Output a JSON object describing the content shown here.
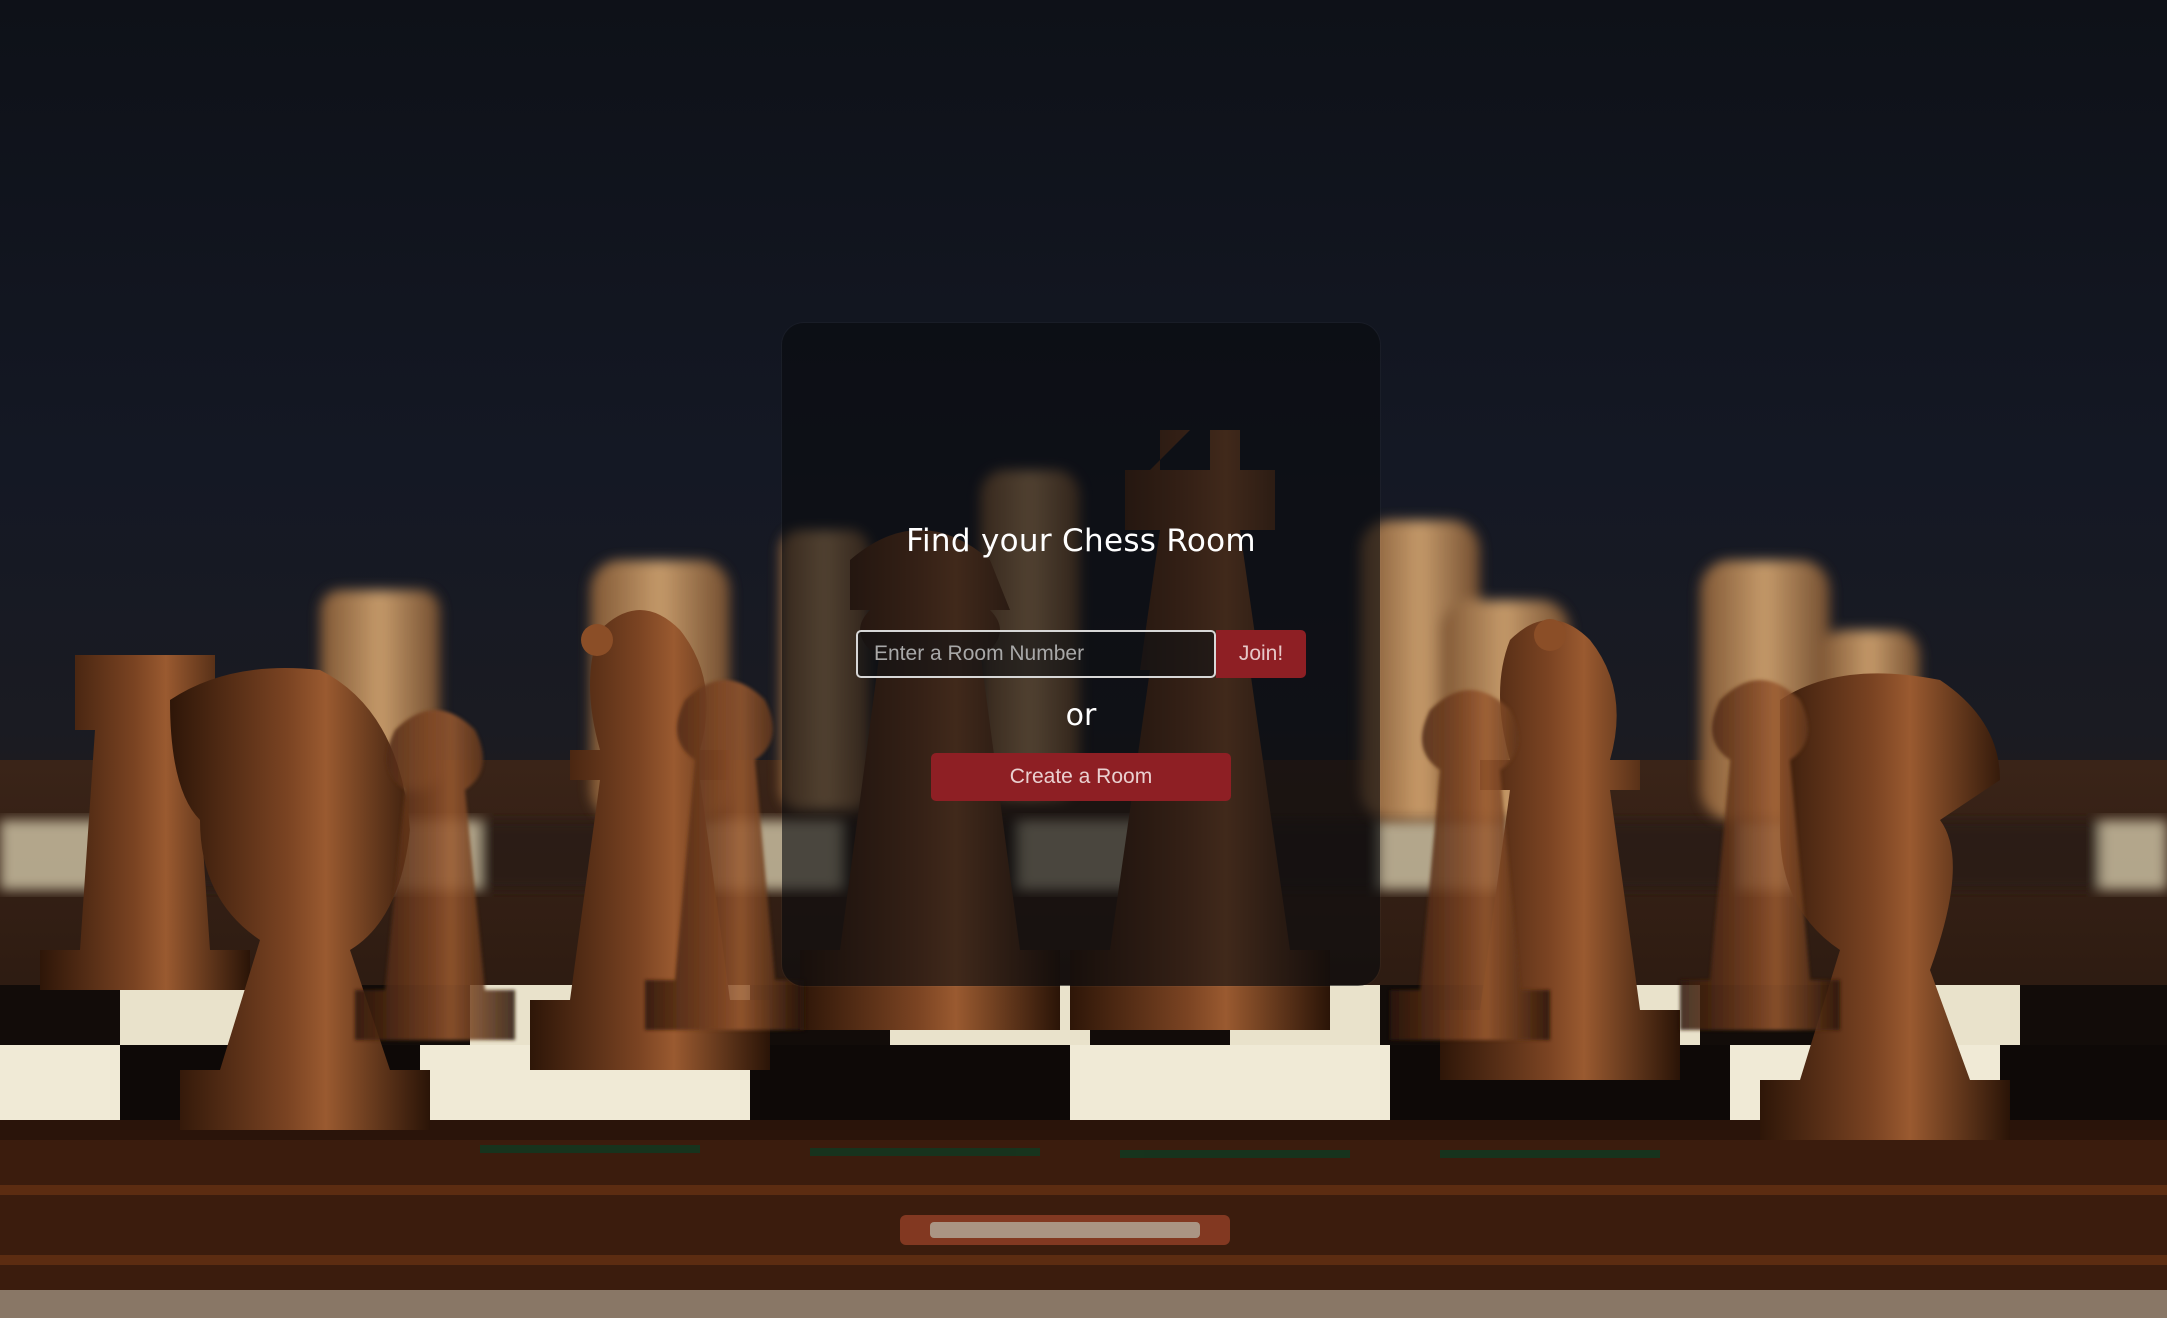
{
  "page": {
    "title": "Find your Chess Room",
    "room_input_placeholder": "Enter a Room Number",
    "join_label": "Join!",
    "or_label": "or",
    "create_label": "Create a Room"
  },
  "colors": {
    "accent": "#8e1f24",
    "card_background": "rgba(10,11,14,0.62)",
    "text": "#ffffff"
  },
  "background": {
    "description_icon": "chess-board-photo"
  }
}
